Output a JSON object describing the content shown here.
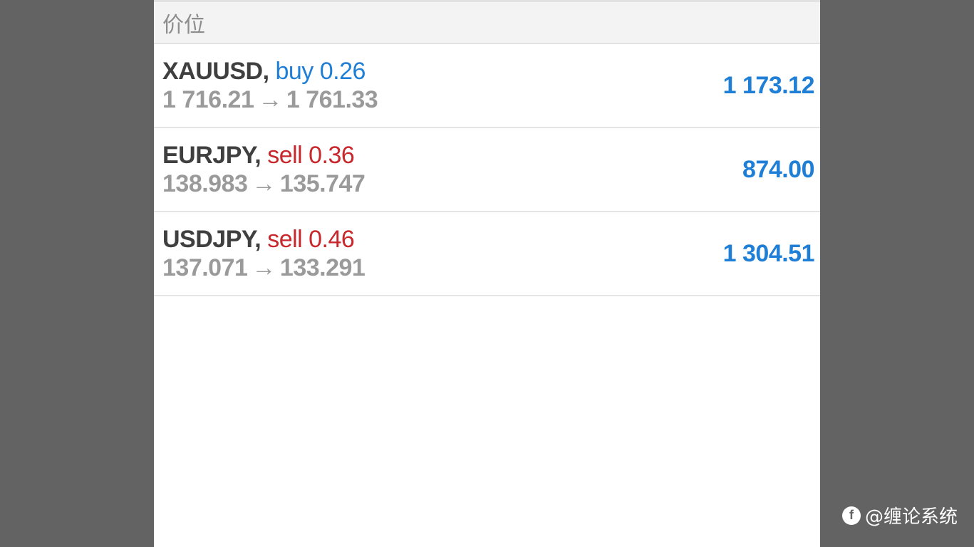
{
  "section": {
    "title": "价位"
  },
  "trades": [
    {
      "symbol": "XAUUSD,",
      "side": "buy 0.26",
      "side_type": "buy",
      "open_price": "1 716.21",
      "arrow": "→",
      "current_price": "1 761.33",
      "profit": "1 173.12"
    },
    {
      "symbol": "EURJPY,",
      "side": "sell 0.36",
      "side_type": "sell",
      "open_price": "138.983",
      "arrow": "→",
      "current_price": "135.747",
      "profit": "874.00"
    },
    {
      "symbol": "USDJPY,",
      "side": "sell 0.46",
      "side_type": "sell",
      "open_price": "137.071",
      "arrow": "→",
      "current_price": "133.291",
      "profit": "1 304.51"
    }
  ],
  "watermark": {
    "logo_icon": "brand-logo-icon",
    "text": "@缠论系统"
  },
  "colors": {
    "buy": "#1f7fd6",
    "sell": "#c8272c",
    "profit": "#1f7fd6",
    "background": "#636363"
  }
}
